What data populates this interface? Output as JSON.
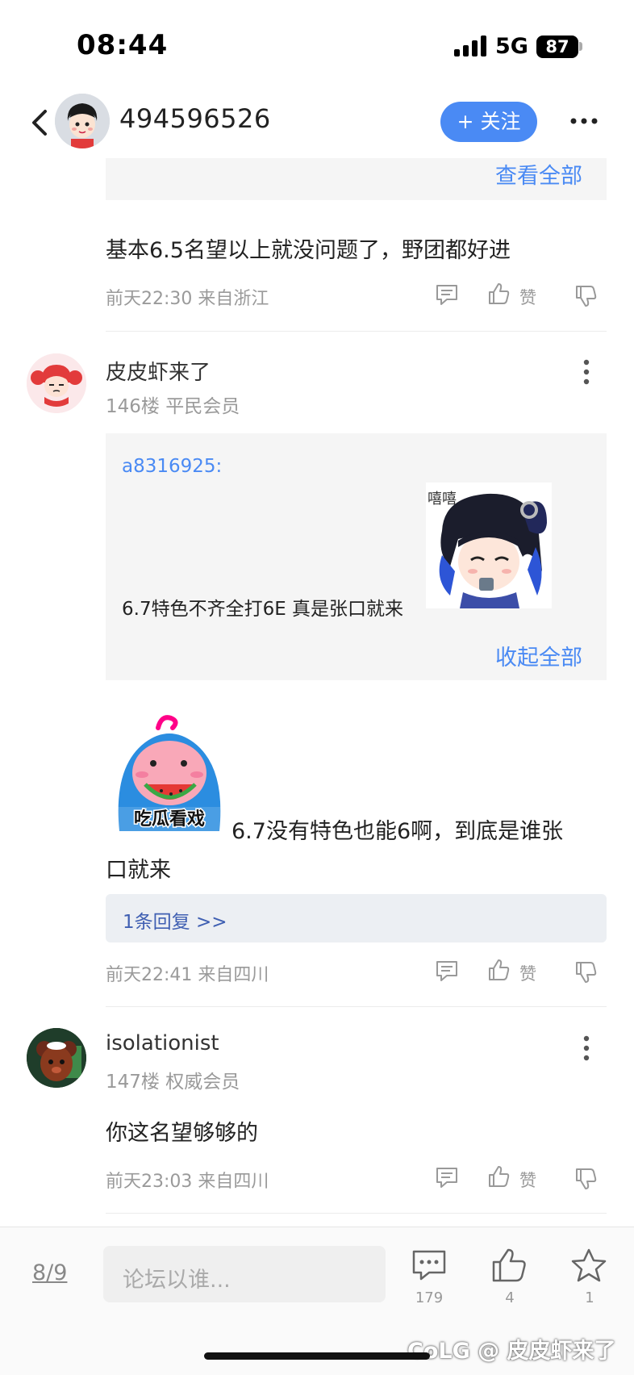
{
  "status_bar": {
    "time": "08:44",
    "network": "5G",
    "battery": "87"
  },
  "header": {
    "username": "494596526",
    "follow_label": "+ 关注"
  },
  "top_quote": {
    "view_all": "查看全部"
  },
  "comment_1": {
    "text": "基本6.5名望以上就没问题了，野团都好进",
    "meta": "前天22:30 来自浙江",
    "like_label": "赞"
  },
  "floor_146": {
    "name": "皮皮虾来了",
    "meta": "146楼 平民会员",
    "quote_user": "a8316925:",
    "quote_text": "6.7特色不齐全打6E 真是张口就来",
    "sticker_caption": "嘻嘻",
    "collapse_label": "收起全部",
    "emoji_caption": "吃瓜看戏",
    "text_line1": "6.7没有特色也能6啊，到底是谁张",
    "text_line2": "口就来",
    "reply_link": "1条回复 >>",
    "time_meta": "前天22:41 来自四川",
    "like_label": "赞"
  },
  "floor_147": {
    "name": "isolationist",
    "meta": "147楼 权威会员",
    "text": "你这名望够够的",
    "time_meta": "前天23:03 来自四川",
    "like_label": "赞"
  },
  "bottom_bar": {
    "page_indicator": "8/9",
    "input_placeholder": "论坛以谁...",
    "comment_count": "179",
    "like_count": "4",
    "star_count": "1"
  },
  "watermark": "CoLG @ 皮皮虾来了",
  "colors": {
    "accent": "#4a8af4",
    "reply_link": "#3f5fb2",
    "meta_gray": "#9a9a9a"
  }
}
